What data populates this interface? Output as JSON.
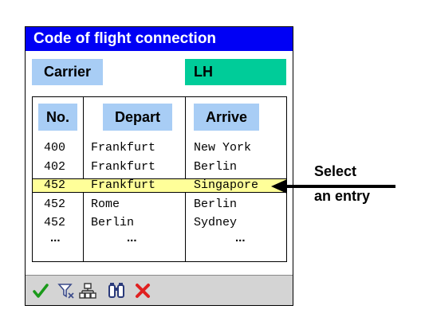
{
  "dialog": {
    "title": "Code of flight connection",
    "carrier_label": "Carrier",
    "carrier_value": "LH"
  },
  "table": {
    "columns": [
      "No.",
      "Depart",
      "Arrive"
    ],
    "rows": [
      {
        "no": "400",
        "depart": "Frankfurt",
        "arrive": "New York",
        "selected": false
      },
      {
        "no": "402",
        "depart": "Frankfurt",
        "arrive": "Berlin",
        "selected": false
      },
      {
        "no": "452",
        "depart": "Frankfurt",
        "arrive": "Singapore",
        "selected": true
      },
      {
        "no": "452",
        "depart": "Rome",
        "arrive": "Berlin",
        "selected": false
      },
      {
        "no": "452",
        "depart": "Berlin",
        "arrive": "Sydney",
        "selected": false
      }
    ],
    "more": {
      "no": "...",
      "depart": "...",
      "arrive": "..."
    }
  },
  "toolbar": {
    "icons": [
      "check-icon",
      "filter-icon",
      "hierarchy-icon",
      "find-icon",
      "cancel-icon"
    ]
  },
  "callout": {
    "line1": "Select",
    "line2": "an entry"
  },
  "colors": {
    "title_bar": "#0000f5",
    "label_bg": "#a8cdf5",
    "value_bg": "#00cc99",
    "selection": "#ffff99"
  }
}
